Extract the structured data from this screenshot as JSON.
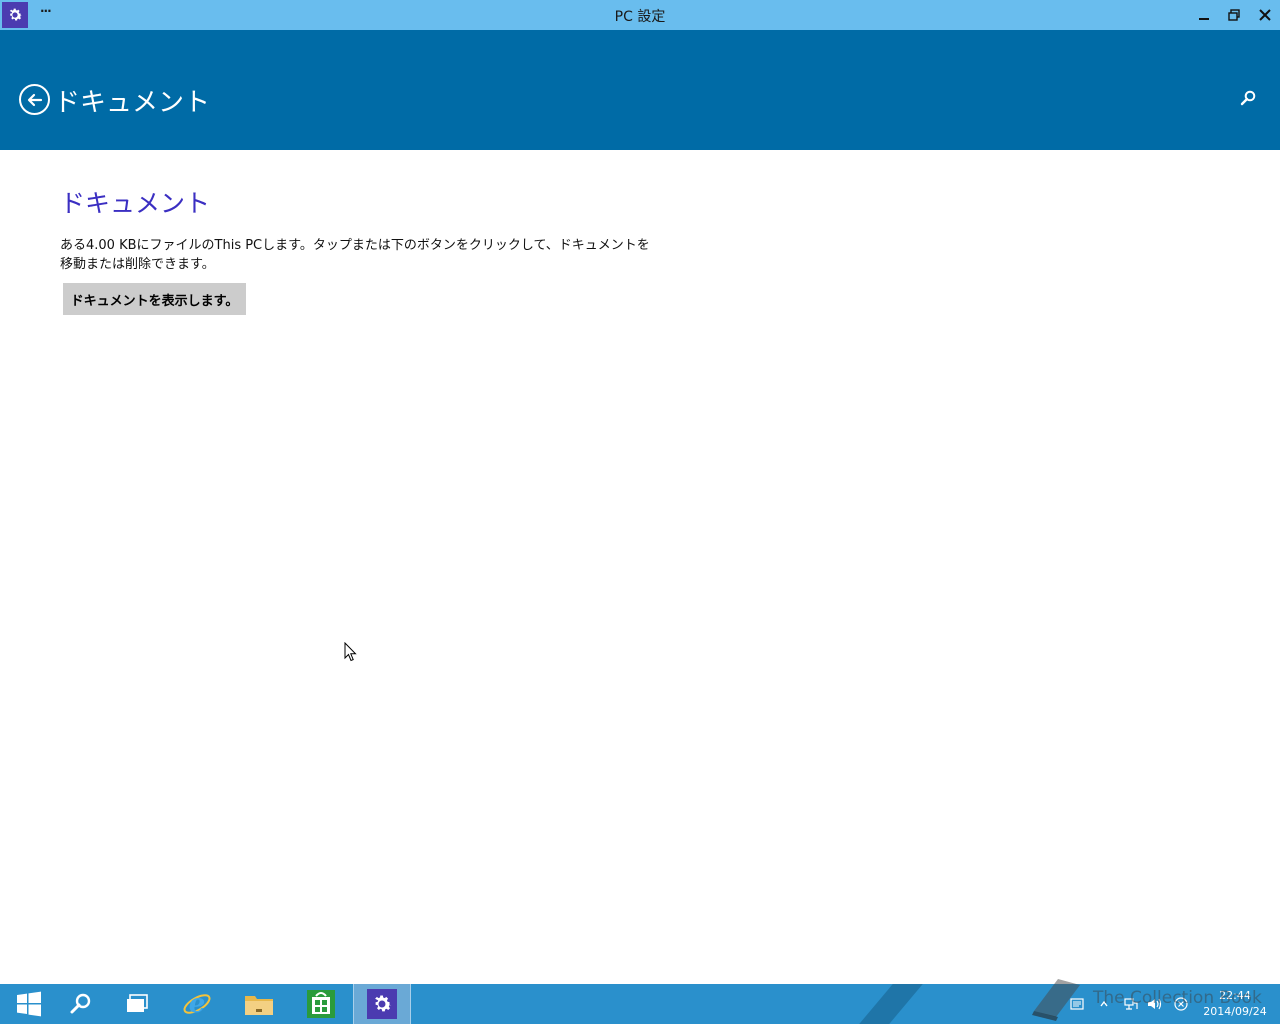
{
  "window": {
    "title": "PC 設定",
    "menu_dots": "···"
  },
  "header": {
    "title": "ドキュメント"
  },
  "content": {
    "heading": "ドキュメント",
    "description": "ある4.00 KBにファイルのThis PCします。タップまたは下のボタンをクリックして、ドキュメントを移動または削除できます。",
    "show_button_label": "ドキュメントを表示します。"
  },
  "taskbar": {
    "items": [
      "start-icon",
      "search-icon",
      "task-view-icon",
      "internet-explorer-icon",
      "file-explorer-icon",
      "store-icon",
      "pc-settings-icon"
    ],
    "clock_time": "22:44",
    "clock_date": "2014/09/24",
    "watermark": "The Collection Book"
  },
  "colors": {
    "titlebar": "#69bdee",
    "header": "#006ba6",
    "heading": "#3b2fc2",
    "taskbar": "#2a90cc",
    "button": "#cccccc"
  }
}
